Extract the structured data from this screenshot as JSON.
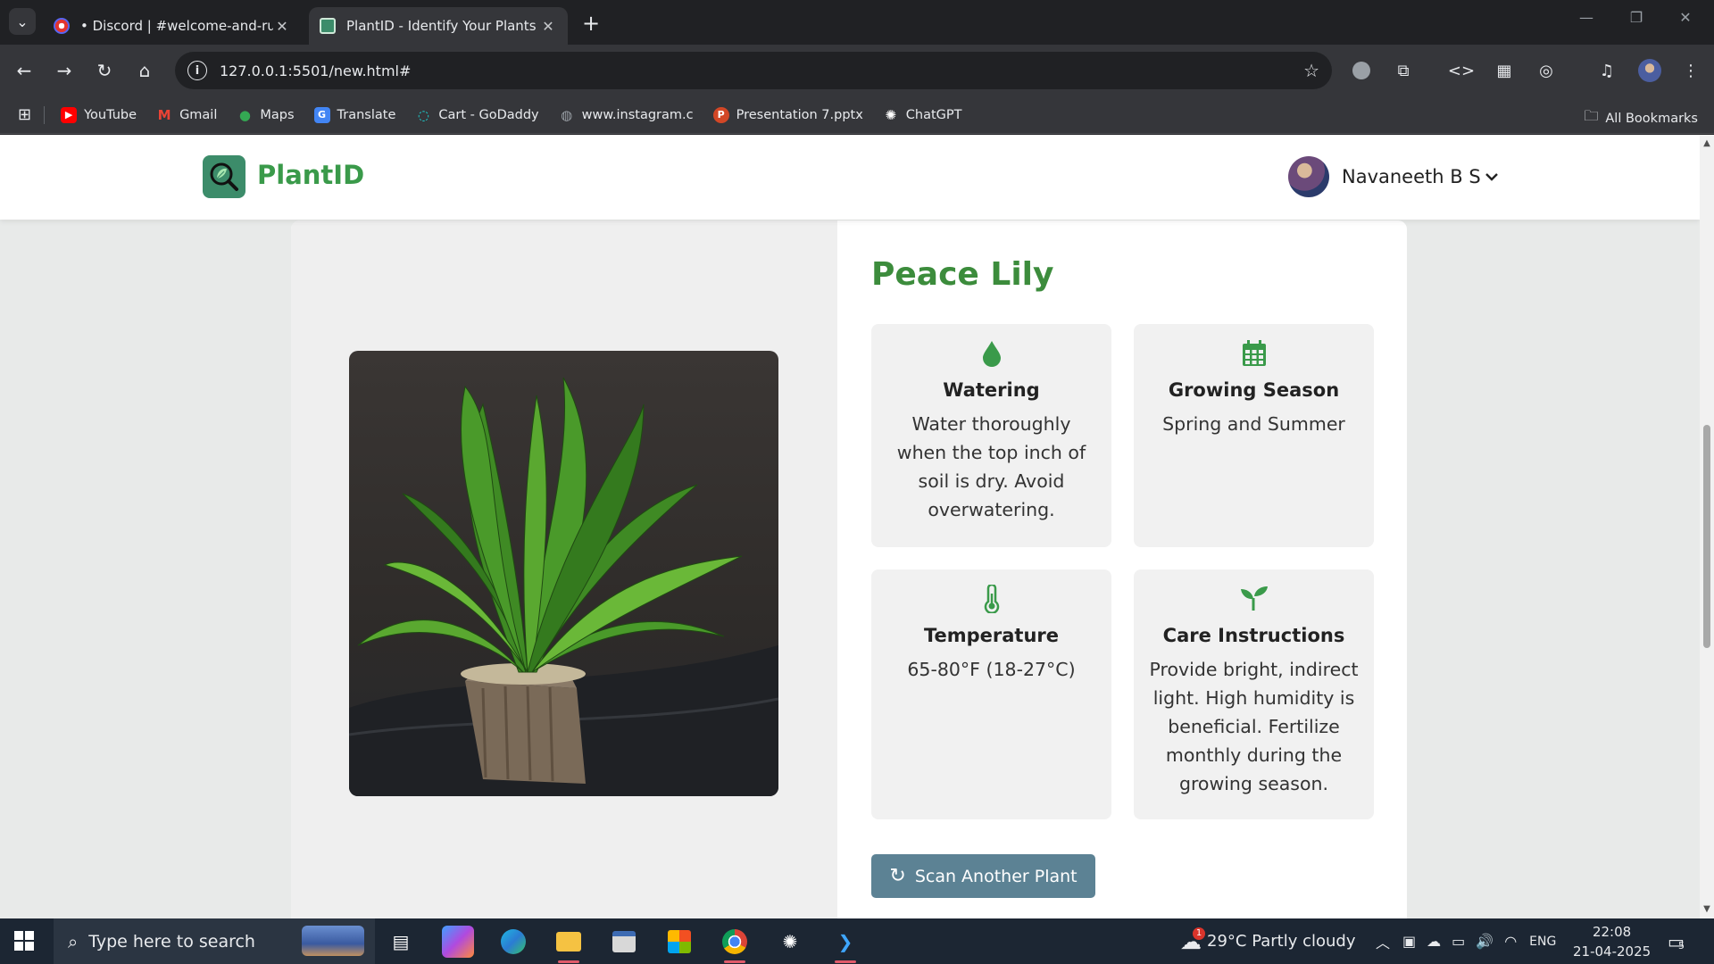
{
  "browser": {
    "tabs": [
      {
        "title": "• Discord | #welcome-and-rules",
        "active": false
      },
      {
        "title": "PlantID - Identify Your Plants",
        "active": true
      }
    ],
    "url": "127.0.0.1:5501/new.html#",
    "bookmarks": [
      {
        "label": "YouTube",
        "icon": "youtube-icon",
        "color": "#ff0000"
      },
      {
        "label": "Gmail",
        "icon": "gmail-icon",
        "color": "#ea4335"
      },
      {
        "label": "Maps",
        "icon": "maps-icon",
        "color": "#34a853"
      },
      {
        "label": "Translate",
        "icon": "translate-icon",
        "color": "#4285f4"
      },
      {
        "label": "Cart - GoDaddy",
        "icon": "godaddy-icon",
        "color": "#1bdbdb"
      },
      {
        "label": "www.instagram.c",
        "icon": "globe-icon",
        "color": "#9aa0a6"
      },
      {
        "label": "Presentation 7.pptx",
        "icon": "powerpoint-icon",
        "color": "#d24726"
      },
      {
        "label": "ChatGPT",
        "icon": "chatgpt-icon",
        "color": "#ffffff"
      }
    ],
    "all_bookmarks": "All Bookmarks"
  },
  "app": {
    "brand": "PlantID",
    "user_name": "Navaneeth B S",
    "accent": "#3c8c3c"
  },
  "plant": {
    "name": "Peace Lily",
    "cards": [
      {
        "icon": "water-drop-icon",
        "heading": "Watering",
        "text": "Water thoroughly when the top inch of soil is dry. Avoid overwatering."
      },
      {
        "icon": "calendar-icon",
        "heading": "Growing Season",
        "text": "Spring and Summer"
      },
      {
        "icon": "thermometer-icon",
        "heading": "Temperature",
        "text": "65-80°F (18-27°C)"
      },
      {
        "icon": "seedling-icon",
        "heading": "Care Instructions",
        "text": "Provide bright, indirect light. High humidity is beneficial. Fertilize monthly during the growing season."
      }
    ],
    "scan_button": "Scan Another Plant"
  },
  "taskbar": {
    "search_placeholder": "Type here to search",
    "weather": "29°C  Partly cloudy",
    "language": "ENG",
    "time": "22:08",
    "date": "21-04-2025",
    "notifications": "5",
    "weather_badge": "1"
  }
}
